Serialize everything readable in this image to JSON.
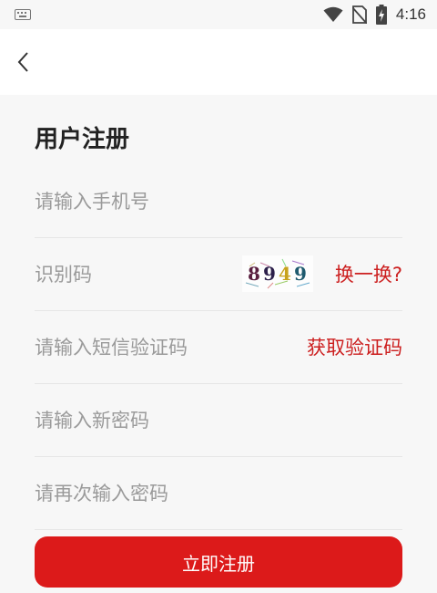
{
  "status_bar": {
    "time": "4:16"
  },
  "page": {
    "title": "用户注册"
  },
  "form": {
    "phone_placeholder": "请输入手机号",
    "captcha_placeholder": "识别码",
    "captcha_code": [
      "8",
      "9",
      "4",
      "9"
    ],
    "captcha_colors": [
      "#5a1f3f",
      "#2c1f4a",
      "#c7a21c",
      "#1f5a6e"
    ],
    "refresh_label": "换一换?",
    "sms_placeholder": "请输入短信验证码",
    "get_code_label": "获取验证码",
    "new_password_placeholder": "请输入新密码",
    "confirm_password_placeholder": "请再次输入密码",
    "submit_label": "立即注册"
  },
  "colors": {
    "accent": "#dc1a1a",
    "link": "#cc1f1f"
  }
}
